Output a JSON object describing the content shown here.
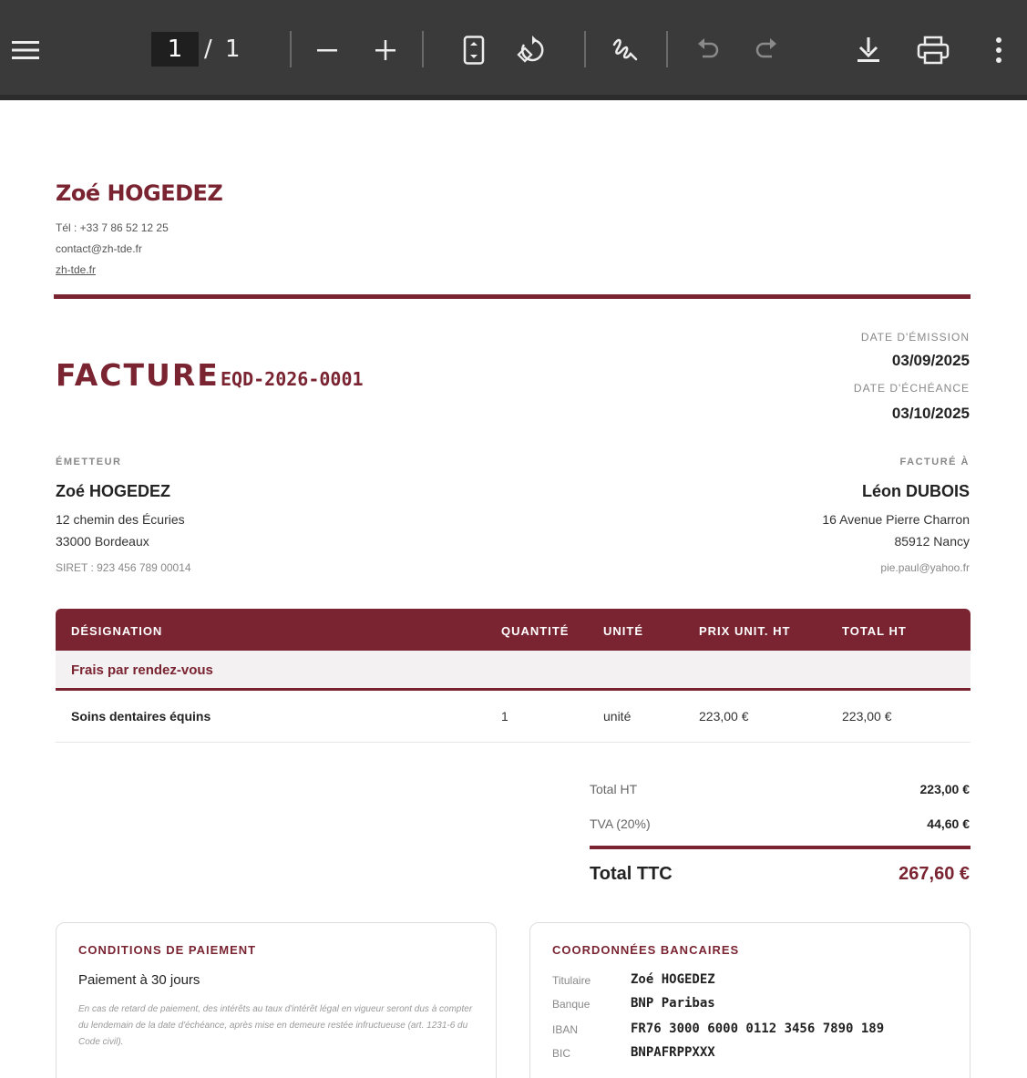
{
  "toolbar": {
    "current_page": "1",
    "page_total": "/ 1",
    "icons": [
      "menu-icon",
      "zoom-out-icon",
      "zoom-in-icon",
      "fit-page-icon",
      "rotate-icon",
      "draw-icon",
      "undo-icon",
      "redo-icon",
      "download-icon",
      "print-icon",
      "more-icon"
    ]
  },
  "sender": {
    "name": "Zoé HOGEDEZ",
    "phone": "Tél : +33 7 86 52 12 25",
    "email": "contact@zh-tde.fr",
    "website": "zh-tde.fr"
  },
  "invoice": {
    "title": "FACTURE",
    "number": "EQD-2026-0001",
    "issue_label": "DATE D'ÉMISSION",
    "issue_date": "03/09/2025",
    "due_label": "DATE D'ÉCHÉANCE",
    "due_date": "03/10/2025"
  },
  "emitter": {
    "label": "ÉMETTEUR",
    "name": "Zoé HOGEDEZ",
    "address1": "12 chemin des Écuries",
    "address2": "33000 Bordeaux",
    "siret": "SIRET : 923 456 789 00014"
  },
  "client": {
    "label": "FACTURÉ À",
    "name": "Léon DUBOIS",
    "address1": "16 Avenue Pierre Charron",
    "address2": "85912 Nancy",
    "email": "pie.paul@yahoo.fr"
  },
  "table": {
    "headers": [
      "DÉSIGNATION",
      "QUANTITÉ",
      "UNITÉ",
      "PRIX UNIT. HT",
      "TOTAL HT"
    ],
    "group": "Frais par rendez-vous",
    "rows": [
      {
        "designation": "Soins dentaires équins",
        "quantity": "1",
        "unit": "unité",
        "unit_price": "223,00 €",
        "total": "223,00 €"
      }
    ]
  },
  "totals": {
    "ht_label": "Total HT",
    "ht_value": "223,00 €",
    "tva_label": "TVA (20%)",
    "tva_value": "44,60 €",
    "ttc_label": "Total TTC",
    "ttc_value": "267,60 €"
  },
  "payment": {
    "title": "CONDITIONS DE PAIEMENT",
    "terms": "Paiement à 30 jours",
    "note": "En cas de retard de paiement, des intérêts au taux d'intérêt légal en vigueur seront dus à compter du lendemain de la date d'échéance, après mise en demeure restée infructueuse (art. 1231-6 du Code civil)."
  },
  "bank": {
    "title": "COORDONNÉES BANCAIRES",
    "holder_label": "Titulaire",
    "holder": "Zoé HOGEDEZ",
    "bank_label": "Banque",
    "bank": "BNP Paribas",
    "iban_label": "IBAN",
    "iban": "FR76 3000 6000 0112 3456 7890 189",
    "bic_label": "BIC",
    "bic": "BNPAFRPPXXX"
  },
  "colors": {
    "accent": "#7a2432",
    "toolbar": "#3a3a3a"
  }
}
